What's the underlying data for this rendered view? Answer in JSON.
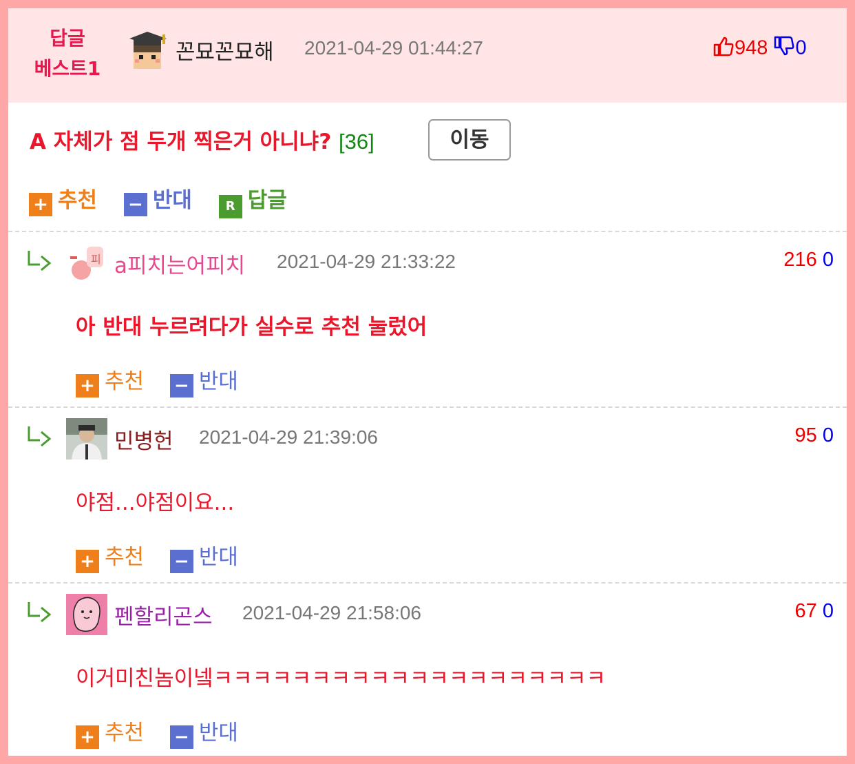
{
  "best": {
    "badge_line1": "답글",
    "badge_line2": "베스트1",
    "author": "꼰묘꼰묘해",
    "date": "2021-04-29 01:44:27",
    "up_count": "948",
    "down_count": "0",
    "title": "A 자체가 점 두개 찍은거 아니냐?",
    "comment_count": "[36]",
    "move_label": "이동",
    "actions": {
      "up": "추천",
      "down": "반대",
      "reply": "답글"
    }
  },
  "comments": [
    {
      "author": "a피치는어피치",
      "date": "2021-04-29 21:33:22",
      "up": "216",
      "down": "0",
      "text": "아 반대 누르려다가 실수로 추천 눌렀어",
      "author_color": "#e9488e"
    },
    {
      "author": "민병헌",
      "date": "2021-04-29 21:39:06",
      "up": "95",
      "down": "0",
      "text": "야점...야점이요...",
      "author_color": "#8a1c1c"
    },
    {
      "author": "펜할리곤스",
      "date": "2021-04-29 21:58:06",
      "up": "67",
      "down": "0",
      "text": "이거미친놈이넼ㅋㅋㅋㅋㅋㅋㅋㅋㅋㅋㅋㅋㅋㅋㅋㅋㅋㅋㅋㅋ",
      "author_color": "#9b1fa8"
    }
  ],
  "comment_actions": {
    "up": "추천",
    "down": "반대"
  },
  "icons": {
    "up": "plus-icon",
    "down": "minus-icon",
    "reply": "reply-icon",
    "thumb_up": "thumbs-up-icon",
    "thumb_down": "thumbs-down-icon",
    "nested": "nested-reply-arrow-icon"
  },
  "colors": {
    "frame": "#ffa6a6",
    "header_bg": "#ffe5e5",
    "accent_red": "#e8172c",
    "up_orange": "#ef7f1a",
    "down_blue": "#5a6fd0",
    "reply_green": "#4a9c2f"
  }
}
